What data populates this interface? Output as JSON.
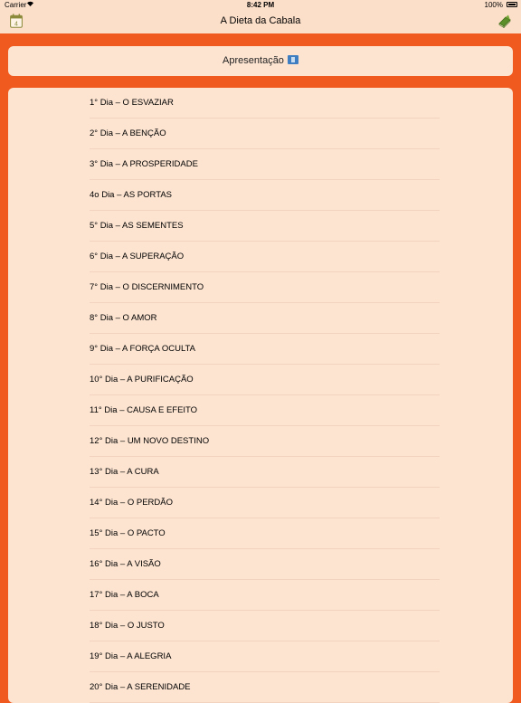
{
  "status_bar": {
    "carrier": "Carrier",
    "time": "8:42 PM",
    "battery": "100%"
  },
  "nav": {
    "title": "A Dieta da Cabala",
    "calendar_icon": "calendar-icon",
    "calendar_day": "4",
    "book_icon": "book-icon"
  },
  "intro": {
    "label": "Apresentação",
    "icon": "film-icon"
  },
  "colors": {
    "background": "#f05a1e",
    "bar": "#fcdfc9",
    "card": "#fde4d1"
  },
  "days": [
    "1° Dia – O ESVAZIAR",
    "2° Dia – A BENÇÃO",
    "3° Dia – A PROSPERIDADE",
    "4o Dia – AS PORTAS",
    "5° Dia – AS SEMENTES",
    "6° Dia – A SUPERAÇÃO",
    "7° Dia – O DISCERNIMENTO",
    "8° Dia – O AMOR",
    "9° Dia – A FORÇA OCULTA",
    "10° Dia – A PURIFICAÇÃO",
    "11° Dia – CAUSA E EFEITO",
    "12° Dia – UM NOVO DESTINO",
    "13° Dia – A CURA",
    "14° Dia – O PERDÃO",
    "15° Dia – O PACTO",
    "16° Dia – A VISÃO",
    "17° Dia – A BOCA",
    "18° Dia – O JUSTO",
    "19° Dia – A ALEGRIA",
    "20° Dia – A SERENIDADE"
  ]
}
